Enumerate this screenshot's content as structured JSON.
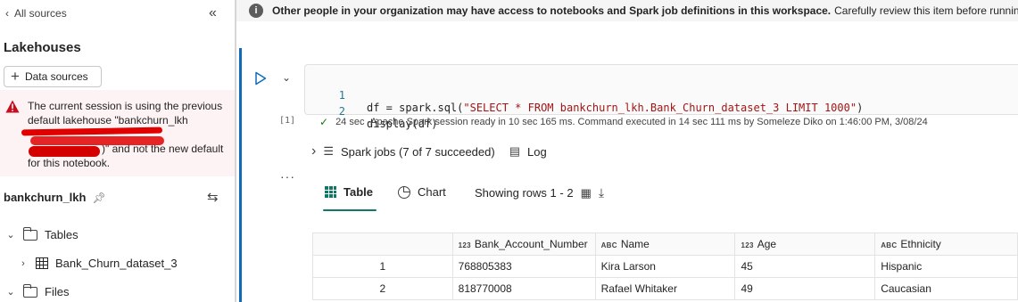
{
  "left_panel": {
    "back_label": "All sources",
    "title": "Lakehouses",
    "data_sources_label": "Data sources",
    "warning": {
      "line1": "The current session is using the previous",
      "line2": "default lakehouse \"bankchurn_lkh",
      "line4_tail": ")\" and not the new default",
      "line5": "for this notebook."
    },
    "lakehouse_name": "bankchurn_lkh",
    "tree": {
      "tables_label": "Tables",
      "table_item": "Bank_Churn_dataset_3",
      "files_label": "Files"
    }
  },
  "info_bar": {
    "bold_text": "Other people in your organization may have access to notebooks and Spark job definitions in this workspace.",
    "normal_text": "Carefully review this item before running"
  },
  "cell": {
    "code": [
      {
        "num": "1",
        "pre": "df = spark.sql(",
        "str": "\"SELECT * FROM bankchurn_lkh.Bank_Churn_dataset_3 LIMIT 1000\"",
        "post": ")"
      },
      {
        "num": "2",
        "pre": "display(df)",
        "str": "",
        "post": ""
      }
    ],
    "exec_count": "[1]",
    "duration": "24 sec",
    "status": "-Apache Spark session ready in 10 sec 165 ms. Command executed in 14 sec 111 ms by Someleze Diko on 1:46:00 PM, 3/08/24",
    "spark_jobs": "Spark jobs (7 of 7 succeeded)",
    "log_label": "Log"
  },
  "output": {
    "tabs": {
      "table": "Table",
      "chart": "Chart",
      "showing": "Showing rows 1 - 2"
    },
    "columns": [
      {
        "type": "123",
        "name": "Bank_Account_Number"
      },
      {
        "type": "ABC",
        "name": "Name"
      },
      {
        "type": "123",
        "name": "Age"
      },
      {
        "type": "ABC",
        "name": "Ethnicity"
      }
    ],
    "rows": [
      {
        "idx": "1",
        "account": "768805383",
        "name": "Kira Larson",
        "age": "45",
        "ethnicity": "Hispanic"
      },
      {
        "idx": "2",
        "account": "818770008",
        "name": "Rafael Whitaker",
        "age": "49",
        "ethnicity": "Caucasian"
      }
    ]
  },
  "colors": {
    "accent": "#0f6cbd",
    "table_tab": "#117865",
    "warning_bg": "#fdf3f4",
    "warning_icon": "#c50f1f",
    "success": "#107c10"
  }
}
